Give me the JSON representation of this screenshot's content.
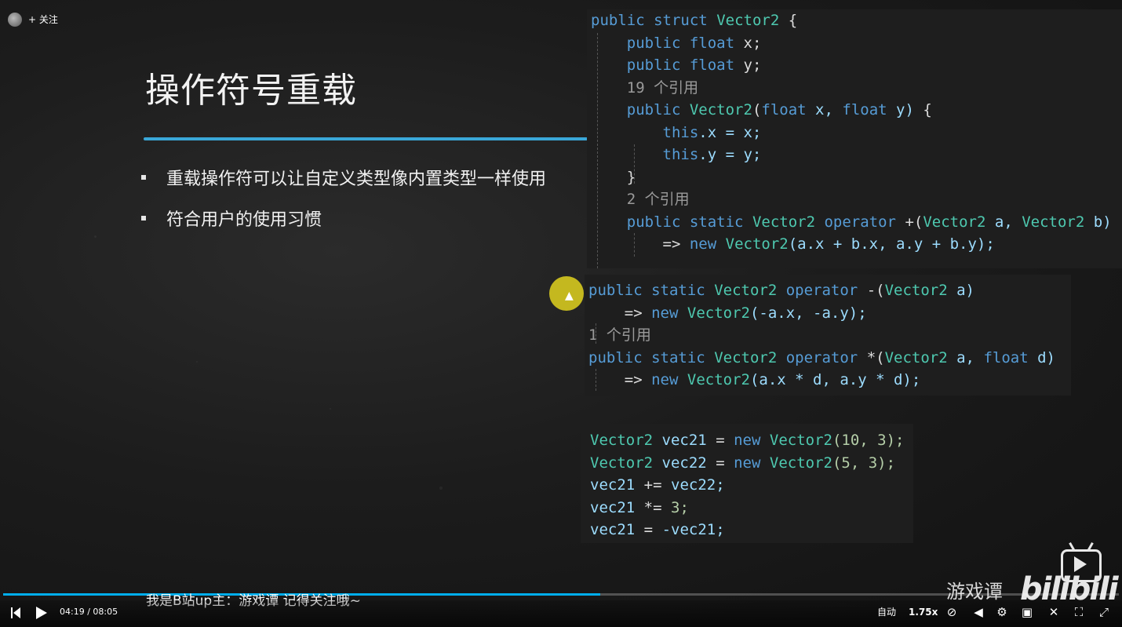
{
  "header": {
    "follow_label": "+ 关注"
  },
  "slide": {
    "title": "操作符号重载",
    "bullets": [
      "重载操作符可以让自定义类型像内置类型一样使用",
      "符合用户的使用习惯"
    ]
  },
  "code_panel_1": {
    "l1": [
      "public",
      "struct",
      "Vector2",
      "{"
    ],
    "l2": [
      "public",
      "float",
      "x;"
    ],
    "l3": [
      "public",
      "float",
      "y;"
    ],
    "l4": "19 个引用",
    "l5": [
      "public",
      "Vector2",
      "(",
      "float",
      "x,",
      "float",
      "y)",
      "{"
    ],
    "l6": [
      "this",
      ".x = x;"
    ],
    "l7": [
      "this",
      ".y = y;"
    ],
    "l8": "}",
    "l9": "2 个引用",
    "l10": [
      "public",
      "static",
      "Vector2",
      "operator",
      "+(",
      "Vector2",
      "a,",
      "Vector2",
      "b)"
    ],
    "l11": [
      "=>",
      "new",
      "Vector2",
      "(a.x + b.x, a.y + b.y);"
    ]
  },
  "code_panel_2": {
    "l1": [
      "public",
      "static",
      "Vector2",
      "operator",
      "-(",
      "Vector2",
      "a)"
    ],
    "l2": [
      "=>",
      "new",
      "Vector2",
      "(-a.x, -a.y);"
    ],
    "l3": "1 个引用",
    "l4": [
      "public",
      "static",
      "Vector2",
      "operator",
      "*(",
      "Vector2",
      "a,",
      "float",
      "d)"
    ],
    "l5": [
      "=>",
      "new",
      "Vector2",
      "(a.x * d, a.y * d);"
    ]
  },
  "code_panel_3": {
    "l1": [
      "Vector2",
      "vec21",
      "=",
      "new",
      "Vector2",
      "(10, 3);"
    ],
    "l2": [
      "Vector2",
      "vec22",
      "=",
      "new",
      "Vector2",
      "(5, 3);"
    ],
    "l3": [
      "vec21",
      "+=",
      "vec22;"
    ],
    "l4": [
      "vec21",
      "*=",
      "3;"
    ],
    "l5": [
      "vec21",
      "=",
      "-vec21;"
    ]
  },
  "overlay": {
    "marquee": "我是B站up主：游戏谭    记得关注哦~",
    "brand": "游戏谭",
    "logo": "bilibili"
  },
  "player": {
    "current_time": "04:19",
    "separator": "/",
    "duration": "08:05",
    "progress_fraction": 0.535,
    "quality_label": "自动",
    "speed_label": "1.75x"
  },
  "colors": {
    "accent": "#00aeec",
    "title_underline": "#3aa7d8",
    "cursor_highlight": "#e1d21e"
  }
}
